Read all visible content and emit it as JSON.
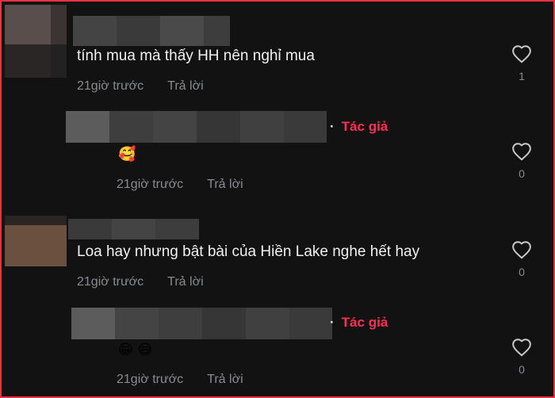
{
  "comments": [
    {
      "text": "tính mua mà thấy HH nên nghỉ mua",
      "time": "21giờ trước",
      "reply": "Trả lời",
      "likes": "1"
    },
    {
      "author_badge": "Tác giả",
      "emoji": "🥰",
      "time": "21giờ trước",
      "reply": "Trả lời",
      "likes": "0"
    },
    {
      "text": "Loa hay nhưng bật bài của Hiền Lake nghe hết hay",
      "time": "21giờ trước",
      "reply": "Trả lời",
      "likes": "0"
    },
    {
      "author_badge": "Tác giả",
      "emoji": "😁 😅",
      "time": "21giờ trước",
      "reply": "Trả lời",
      "likes": "0"
    }
  ],
  "colors": {
    "background": "#121212",
    "frame_border": "#e8323f",
    "author_badge": "#fe2c55",
    "comment_text": "#f1f1f2",
    "meta_text": "#8a8b91"
  },
  "icons": {
    "like": "heart-outline-icon"
  }
}
